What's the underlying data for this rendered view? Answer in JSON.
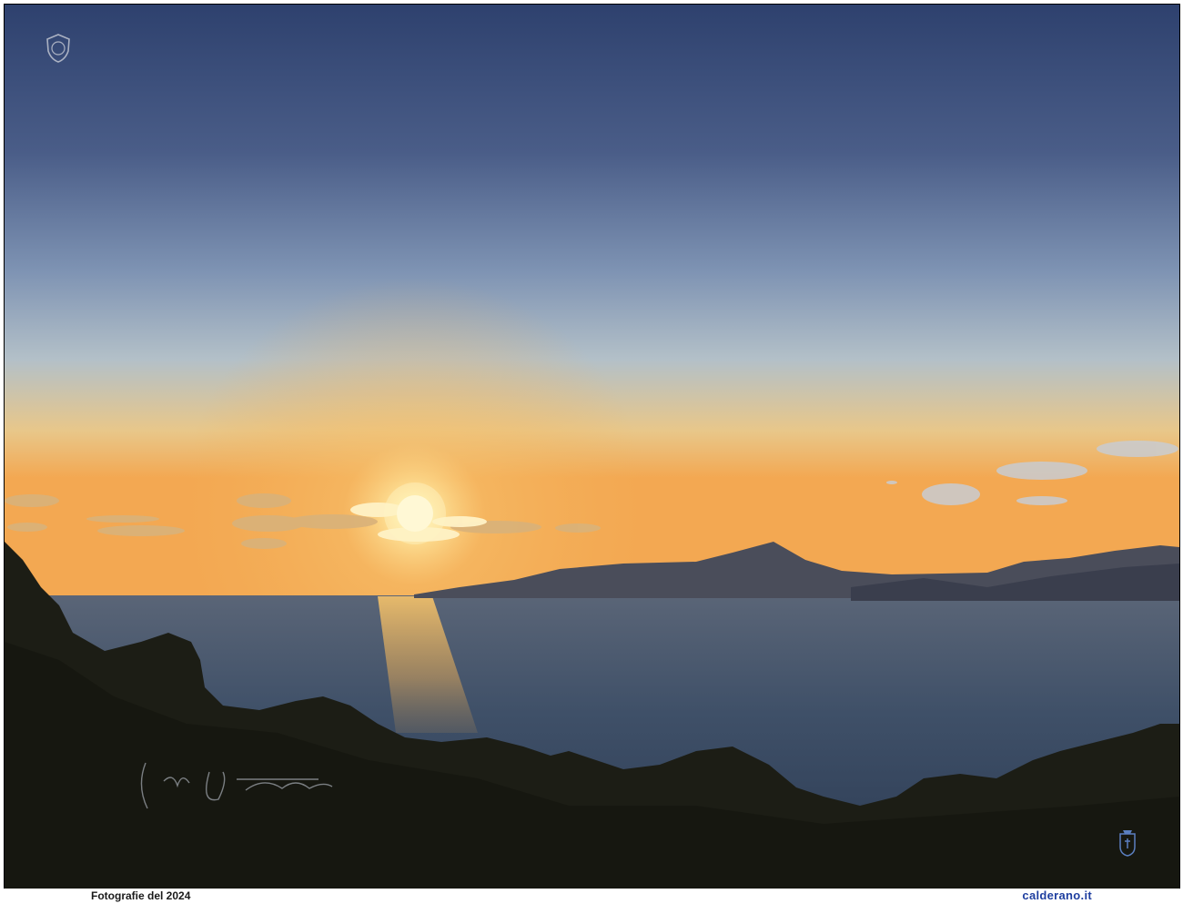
{
  "footer": {
    "caption": "Fotografie del 2024",
    "site": "calderano.it"
  },
  "photo": {
    "subject": "Sunset over the sea with mountains on the horizon and trees in the foreground",
    "colors": {
      "sky_top": "#2e416e",
      "sky_mid": "#8fa5bf",
      "sky_horizon": "#f2b25a",
      "sun": "#fff6d0",
      "sea": "#3f5068",
      "mountains": "#3d4150",
      "trees": "#1c1d15"
    }
  },
  "watermarks": {
    "crest_icon": "crest-icon",
    "signature": "signature-mark",
    "badge_icon": "shield-badge-icon"
  }
}
